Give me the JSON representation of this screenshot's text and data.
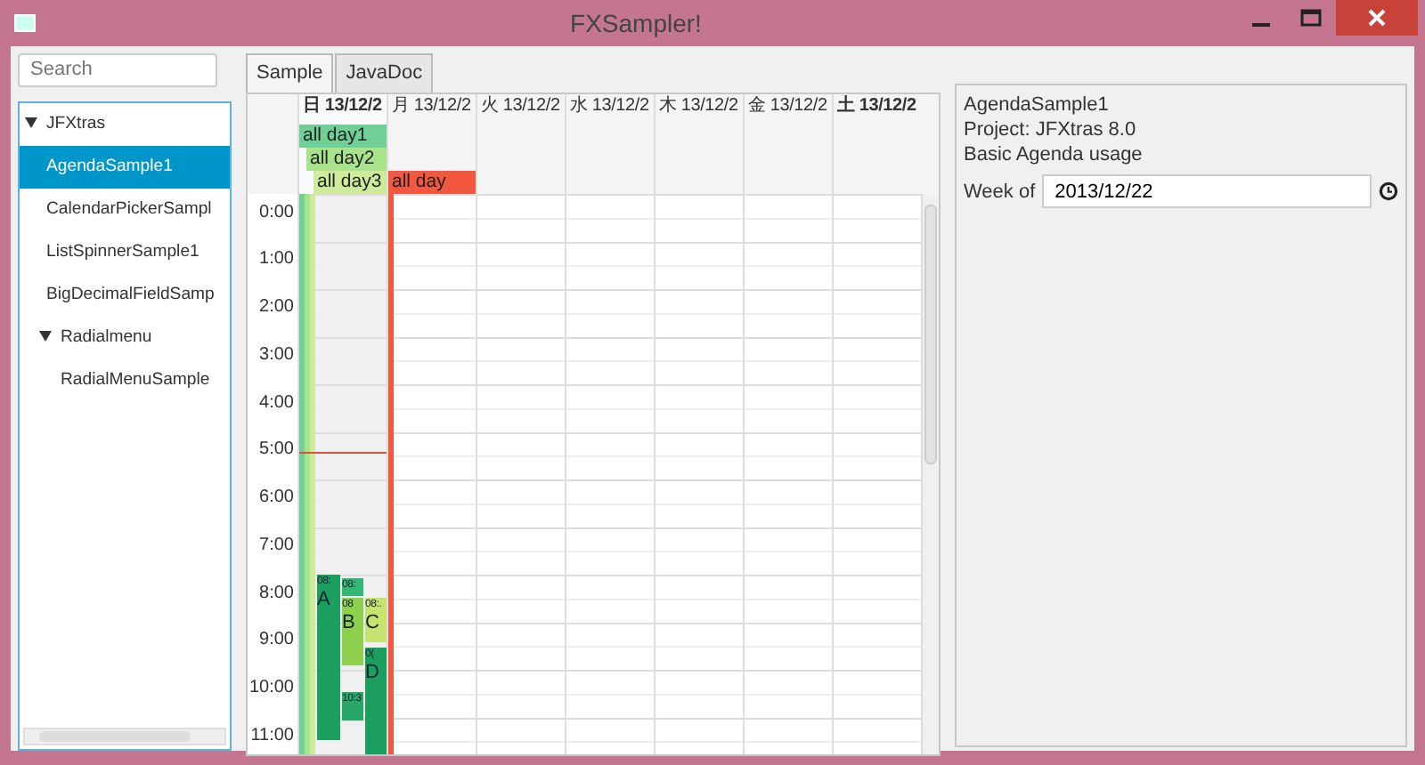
{
  "window": {
    "title": "FXSampler!"
  },
  "search": {
    "placeholder": "Search"
  },
  "tree": [
    {
      "label": "JFXtras",
      "expanded": true,
      "selected": false,
      "children": [
        {
          "label": "AgendaSample1",
          "selected": true
        },
        {
          "label": "CalendarPickerSampl",
          "selected": false
        },
        {
          "label": "ListSpinnerSample1",
          "selected": false
        },
        {
          "label": "BigDecimalFieldSamp",
          "selected": false
        },
        {
          "label": "Radialmenu",
          "expanded": true,
          "selected": false,
          "children": [
            {
              "label": "RadialMenuSample",
              "selected": false
            }
          ]
        }
      ]
    }
  ],
  "tabs": [
    {
      "label": "Sample",
      "selected": true
    },
    {
      "label": "JavaDoc",
      "selected": false
    }
  ],
  "agenda": {
    "days": [
      {
        "label": "日 13/12/2",
        "weekend": true,
        "today": true,
        "all_day_events": [
          {
            "label": "all day1",
            "color": "#6fcf97"
          },
          {
            "label": "all day2",
            "color": "#a8e28a"
          },
          {
            "label": "all day3",
            "color": "#cdeb9b"
          }
        ],
        "events": [
          {
            "time": "08:",
            "title": "A",
            "color": "#1b9e5e"
          },
          {
            "time": "08:",
            "color": "#36b874"
          },
          {
            "time": "08",
            "title": "B",
            "color": "#8fd14f"
          },
          {
            "time": "08:.",
            "title": "C",
            "color": "#c6e36f"
          },
          {
            "time": "0(",
            "title": "D",
            "color": "#1b9e5e"
          },
          {
            "time": "10:3",
            "color": "#27a866"
          }
        ]
      },
      {
        "label": "月 13/12/2",
        "weekend": false,
        "today": false,
        "all_day_events": [
          {
            "label": "all day",
            "color": "#f2573f"
          }
        ]
      },
      {
        "label": "火 13/12/2",
        "weekend": false,
        "today": false
      },
      {
        "label": "水 13/12/2",
        "weekend": false,
        "today": false
      },
      {
        "label": "木 13/12/2",
        "weekend": false,
        "today": false
      },
      {
        "label": "金 13/12/2",
        "weekend": false,
        "today": false
      },
      {
        "label": "土 13/12/2",
        "weekend": true,
        "today": false
      }
    ],
    "hours": [
      "0:00",
      "1:00",
      "2:00",
      "3:00",
      "4:00",
      "5:00",
      "6:00",
      "7:00",
      "8:00",
      "9:00",
      "10:00",
      "11:00"
    ]
  },
  "info": {
    "title": "AgendaSample1",
    "project": "Project: JFXtras 8.0",
    "description": "Basic Agenda usage",
    "week_label": "Week of",
    "week_value": "2013/12/22"
  }
}
